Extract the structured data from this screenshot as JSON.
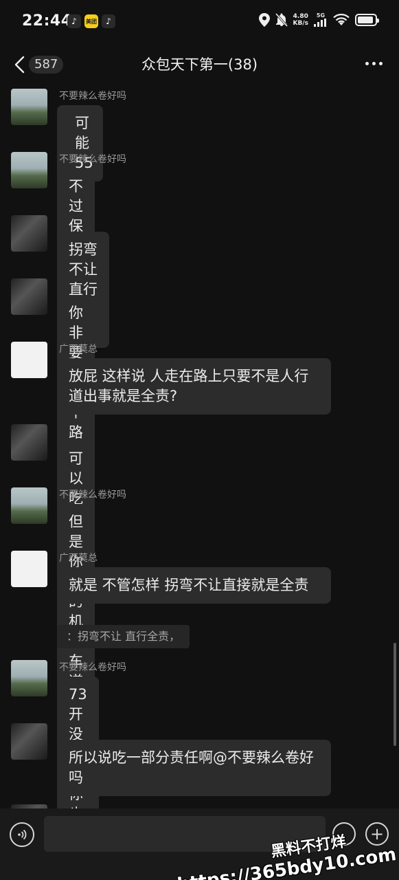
{
  "status_bar": {
    "time": "22:44",
    "app_icons": [
      "tiktok-icon",
      "meituan-icon",
      "tiktok-icon"
    ],
    "meituan_label": "美团",
    "net_speed_value": "4.80",
    "net_speed_unit": "KB/s",
    "network": "5G",
    "battery_level": 0.9
  },
  "header": {
    "unread_count": "587",
    "title": "众包天下第一(38)"
  },
  "messages": [
    {
      "sender": "不要辣么卷好吗",
      "text": "可能 55",
      "avatar": "lake"
    },
    {
      "sender": "不要辣么卷好吗",
      "text": "不过保险应该够赔",
      "avatar": "lake"
    },
    {
      "sender": "",
      "text": "拐弯不让 直行全责，",
      "avatar": "bw"
    },
    {
      "sender": "",
      "text": "你非要扯一个路权",
      "avatar": "bw"
    },
    {
      "sender": "广西莫总",
      "text": "放屁  这样说  人走在路上只要不是人行道出事就是全责?",
      "avatar": "card"
    },
    {
      "sender": "",
      "text": "可以吃一部分责任",
      "avatar": "bw"
    },
    {
      "sender": "不要辣么卷好吗",
      "text": "但是你走的机动车道",
      "avatar": "lake"
    },
    {
      "sender": "广西莫总",
      "text": "就是  不管怎样  拐弯不让直接就是全责",
      "avatar": "card",
      "quote": "：拐弯不让 直行全责，"
    },
    {
      "sender": "不要辣么卷好吗",
      "text": "73 开没保险你也吃不消啊",
      "avatar": "lake"
    },
    {
      "sender": "",
      "text": "所以说吃一部分责任啊@不要辣么卷好吗",
      "avatar": "bw"
    }
  ],
  "input_bar": {
    "placeholder": "",
    "icons": [
      "voice-icon",
      "emoji-icon",
      "plus-icon"
    ]
  },
  "watermark": {
    "line1": "黑料不打烊",
    "line2": "https://365bdy10.com"
  }
}
